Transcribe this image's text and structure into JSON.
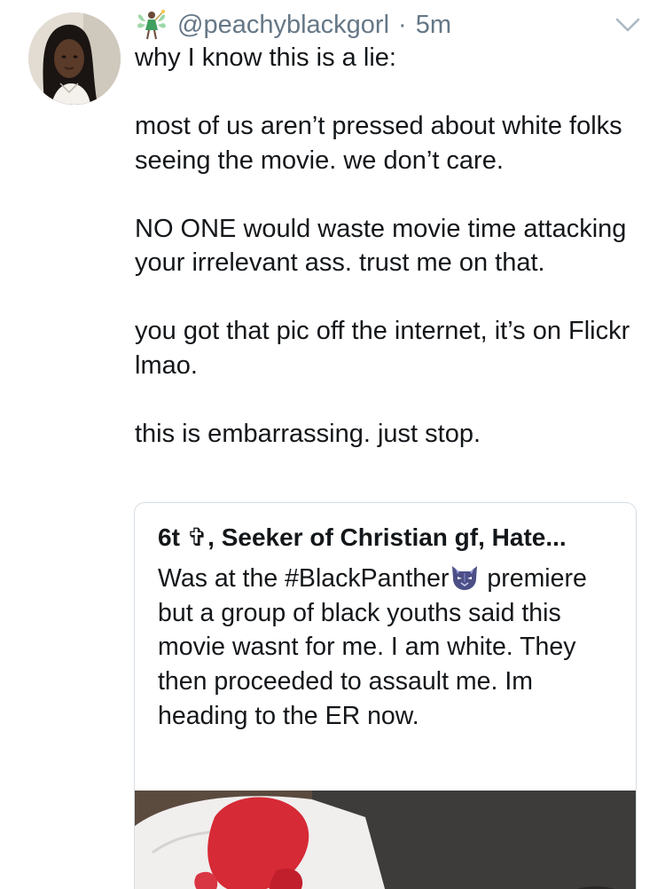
{
  "tweet": {
    "handle": "@peachyblackgorl",
    "separator": "·",
    "time": "5m",
    "avatar_icon": "user-avatar",
    "name_emoji_icon": "fairy-icon",
    "menu_icon": "chevron-down-icon",
    "paragraphs": [
      "why I know this is a lie:",
      "most of us aren’t pressed about white folks seeing the movie. we don’t care.",
      "NO ONE would waste movie time attacking your irrelevant ass. trust me on that.",
      "you got that pic off the internet, it’s on Flickr lmao.",
      "this is embarrassing. just stop."
    ]
  },
  "quoted_tweet": {
    "display_name": "6t ✞, Seeker of Christian gf, Hate...",
    "text_before_emoji": "Was at the #BlackPanther",
    "emoji_icon": "panther-face-icon",
    "text_after_emoji": "premiere but a group of black youths said this movie wasnt for me. I am white. They then proceeded to assault me. Im heading to the ER now.",
    "media_description_icon": "attached-photo"
  },
  "colors": {
    "text": "#14171a",
    "secondary_text": "#657786",
    "border": "#d6dde3",
    "background": "#ffffff"
  }
}
